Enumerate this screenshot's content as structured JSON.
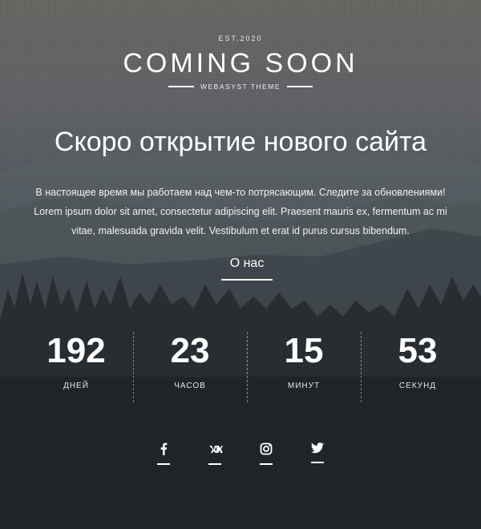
{
  "header": {
    "est": "EST.2020",
    "logo_title": "COMING SOON",
    "logo_subtitle": "WEBASYST THEME"
  },
  "main": {
    "headline": "Скоро открытие нового сайта",
    "description": "В настоящее время мы работаем над чем-то потрясающим. Следите за обновлениями! Lorem ipsum dolor sit amet, consectetur adipiscing elit. Praesent mauris ex, fermentum ac mi vitae, malesuada gravida velit. Vestibulum et erat id purus cursus bibendum.",
    "about_link": "О нас"
  },
  "countdown": [
    {
      "value": "192",
      "label": "ДНЕЙ"
    },
    {
      "value": "23",
      "label": "ЧАСОВ"
    },
    {
      "value": "15",
      "label": "МИНУТ"
    },
    {
      "value": "53",
      "label": "СЕКУНД"
    }
  ],
  "social": [
    {
      "icon": "facebook-icon"
    },
    {
      "icon": "vk-icon"
    },
    {
      "icon": "instagram-icon"
    },
    {
      "icon": "twitter-icon"
    }
  ],
  "colors": {
    "text": "#ffffff",
    "background_top": "#6a6a66",
    "background_bottom": "#191c1e"
  }
}
